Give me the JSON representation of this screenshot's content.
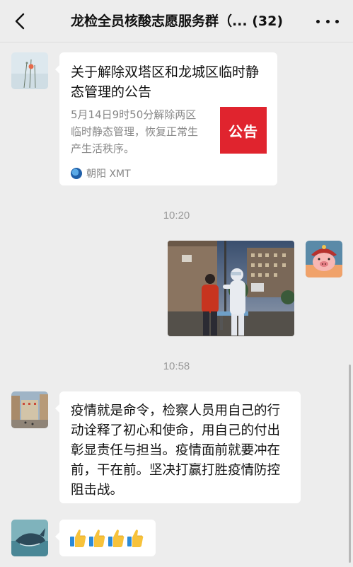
{
  "header": {
    "title": "龙检全员核酸志愿服务群（... (32)"
  },
  "messages": {
    "article": {
      "title": "关于解除双塔区和龙城区临时静态管理的公告",
      "description": "5月14日9时50分解除两区临时静态管理，恢复正常生产生活秩序。",
      "thumb_text": "公告",
      "source": "朝阳 XMT"
    },
    "time1": "10:20",
    "time2": "10:58",
    "text": "疫情就是命令，检察人员用自己的行动诠释了初心和使命，用自己的付出彰显责任与担当。疫情面前就要冲在前，干在前。坚决打赢打胜疫情防控阻击战。"
  },
  "colors": {
    "background": "#ededed",
    "bubble": "#ffffff",
    "notice_red": "#e0242e"
  }
}
